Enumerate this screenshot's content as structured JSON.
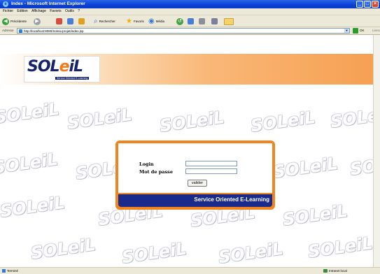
{
  "window": {
    "title": "Index - Microsoft Internet Explorer"
  },
  "menu": [
    "Fichier",
    "Edition",
    "Affichage",
    "Favoris",
    "Outils",
    "?"
  ],
  "toolbar": {
    "back_label": "Précédente",
    "search_label": "Rechercher",
    "favorites_label": "Favoris",
    "media_label": "Média"
  },
  "address": {
    "label": "Adresse",
    "url": "http://localhost:8080/SoleiL/projet/index.jsp",
    "go_label": "OK",
    "links_label": "Liens"
  },
  "page": {
    "logo_text_a": "SOL",
    "logo_text_e": "e",
    "logo_text_b": "iL",
    "logo_subtitle": "Service Oriented E-Learning",
    "watermark_a": "SOL",
    "watermark_e": "e",
    "watermark_b": "iL"
  },
  "login": {
    "login_label": "Login",
    "password_label": "Mot de passe",
    "submit_label": "valider",
    "banner": "Service Oriented E-Learning"
  },
  "status": {
    "left": "Terminé",
    "right": "Intranet local"
  }
}
